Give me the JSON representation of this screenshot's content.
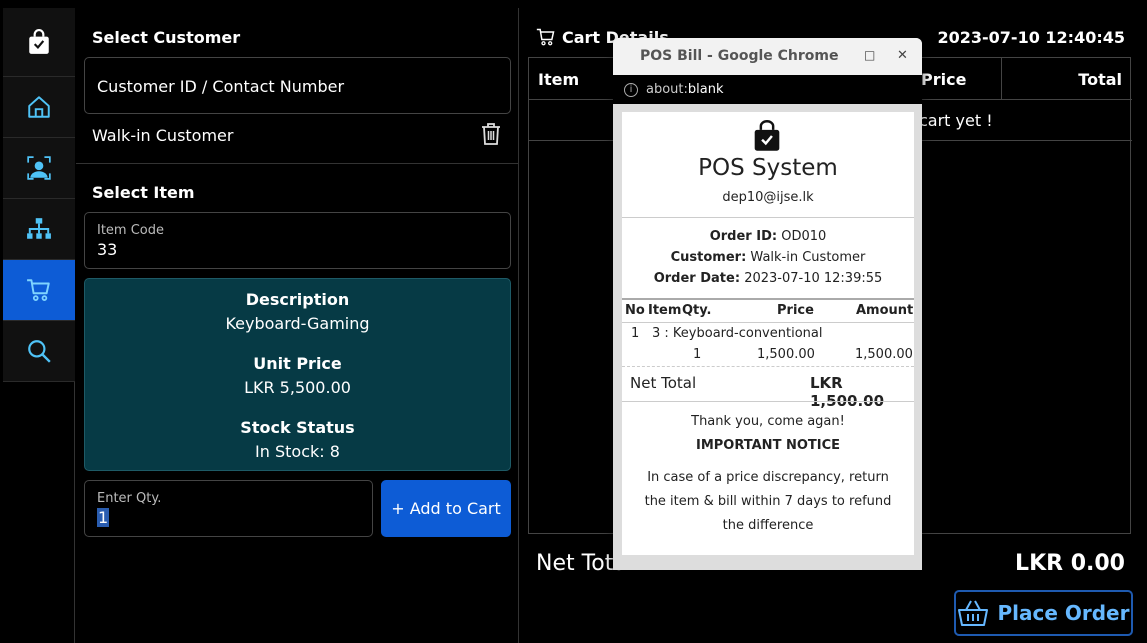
{
  "sidebar": {
    "items": [
      {
        "name": "home"
      },
      {
        "name": "customers"
      },
      {
        "name": "items"
      },
      {
        "name": "cart"
      },
      {
        "name": "search"
      }
    ]
  },
  "customer": {
    "title": "Select Customer",
    "input_placeholder": "Customer ID / Contact Number",
    "selected": "Walk-in Customer"
  },
  "item": {
    "title": "Select Item",
    "code_label": "Item Code",
    "code_value": "33",
    "description_label": "Description",
    "description_value": "Keyboard-Gaming",
    "unit_price_label": "Unit Price",
    "unit_price_value": "LKR 5,500.00",
    "stock_label": "Stock Status",
    "stock_value": "In Stock: 8",
    "qty_label": "Enter Qty.",
    "qty_value": "1",
    "add_button": "+ Add to Cart"
  },
  "cart": {
    "title": "Cart Details",
    "datetime": "2023-07-10 12:40:45",
    "headers": {
      "item": "Item",
      "price": "Price",
      "total": "Total"
    },
    "empty_text": "cart yet !",
    "net_total_label": "Net Total",
    "net_total_value": "LKR 0.00",
    "place_order": "Place Order"
  },
  "popup": {
    "title": "POS Bill - Google Chrome",
    "url_prefix": "about:",
    "url_host": "blank",
    "bill": {
      "shop_name": "POS System",
      "email": "dep10@ijse.lk",
      "order_id_label": "Order ID:",
      "order_id": "OD010",
      "customer_label": "Customer:",
      "customer": "Walk-in Customer",
      "order_date_label": "Order Date:",
      "order_date": "2023-07-10 12:39:55",
      "col_no": "No",
      "col_item": "Item",
      "col_qty": "Qty.",
      "col_price": "Price",
      "col_amount": "Amount",
      "line_no": "1",
      "line_item": "3 : Keyboard-conventional",
      "line_qty": "1",
      "line_price": "1,500.00",
      "line_amount": "1,500.00",
      "net_total_label": "Net Total",
      "net_total_value": "LKR 1,500.00",
      "thanks": "Thank you, come agan!",
      "notice_title": "IMPORTANT NOTICE",
      "notice_text": "In case of a price discrepancy, return the item & bill within 7 days to refund the difference"
    }
  },
  "colors": {
    "accent": "#0d5cd6",
    "info_panel": "#063a45",
    "place_order_text": "#66b8ff"
  }
}
